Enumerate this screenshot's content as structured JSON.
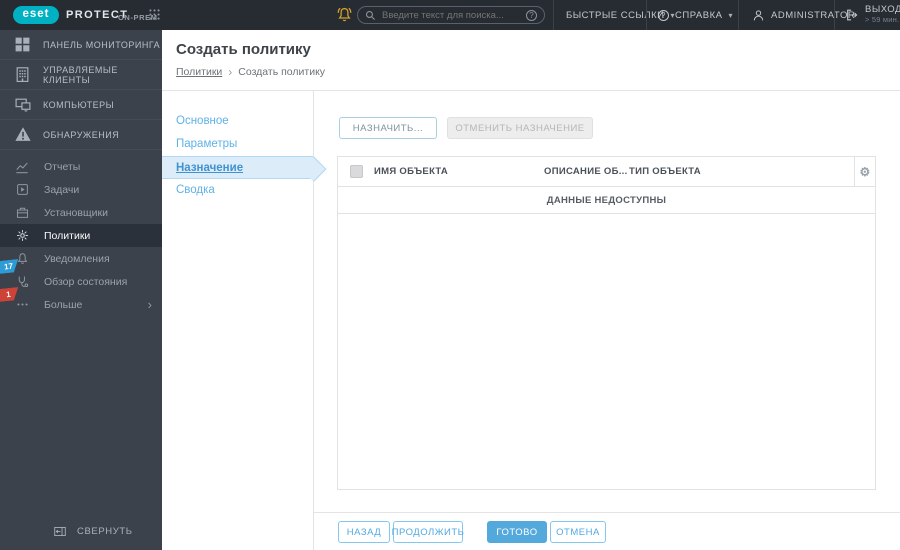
{
  "colors": {
    "brand_cyan": "#00b1c4",
    "topbar_bg": "#272c33",
    "sidebar_bg": "#3b424c",
    "accent_blue": "#54a9dc",
    "link_blue": "#5fb2e6",
    "badge_blue": "#2d9cd6",
    "badge_red": "#ce4338",
    "bell_gold": "#d2a12b"
  },
  "glyphs": {
    "chevron_down": "▾",
    "chevron_right": "›",
    "breadcrumb_separator": "›",
    "question_mark": "?",
    "gear": "⚙"
  },
  "topbar": {
    "logo": {
      "brand": "eset",
      "product": "PROTECT",
      "edition": "ON-PREM"
    },
    "search": {
      "placeholder": "Введите текст для поиска..."
    },
    "quick_links_label": "БЫСТРЫЕ ССЫЛКИ",
    "help_label": "СПРАВКА",
    "user_label": "ADMINISTRATOR",
    "logout": {
      "label": "ВЫХОД",
      "timeout": "> 59 мин."
    }
  },
  "sidebar": {
    "primary_items": [
      {
        "label": "ПАНЕЛЬ МОНИТОРИНГА"
      },
      {
        "label": "УПРАВЛЯЕМЫЕ КЛИЕНТЫ"
      },
      {
        "label": "КОМПЬЮТЕРЫ"
      },
      {
        "label": "ОБНАРУЖЕНИЯ"
      }
    ],
    "secondary_items": [
      {
        "label": "Отчеты"
      },
      {
        "label": "Задачи"
      },
      {
        "label": "Установщики"
      },
      {
        "label": "Политики",
        "active": true
      },
      {
        "label": "Уведомления"
      },
      {
        "label": "Обзор состояния",
        "badge": "17"
      },
      {
        "label": "Больше",
        "badge": "1"
      }
    ],
    "collapse_label": "СВЕРНУТЬ"
  },
  "page": {
    "title": "Создать политику",
    "breadcrumb_parent": "Политики",
    "breadcrumb_current": "Создать политику"
  },
  "wizard": {
    "steps": [
      {
        "label": "Основное"
      },
      {
        "label": "Параметры"
      },
      {
        "label": "Назначение",
        "active": true
      },
      {
        "label": "Сводка"
      }
    ]
  },
  "content": {
    "assign_button": "НАЗНАЧИТЬ...",
    "unassign_button": "ОТМЕНИТЬ НАЗНАЧЕНИЕ",
    "table": {
      "columns": [
        "ИМЯ ОБЪЕКТА",
        "ОПИСАНИЕ ОБ...",
        "ТИП ОБЪЕКТА"
      ],
      "empty_message": "ДАННЫЕ НЕДОСТУПНЫ",
      "rows": []
    },
    "footer_buttons": {
      "back": "НАЗАД",
      "continue": "ПРОДОЛЖИТЬ",
      "finish": "ГОТОВО",
      "cancel": "ОТМЕНА"
    }
  }
}
